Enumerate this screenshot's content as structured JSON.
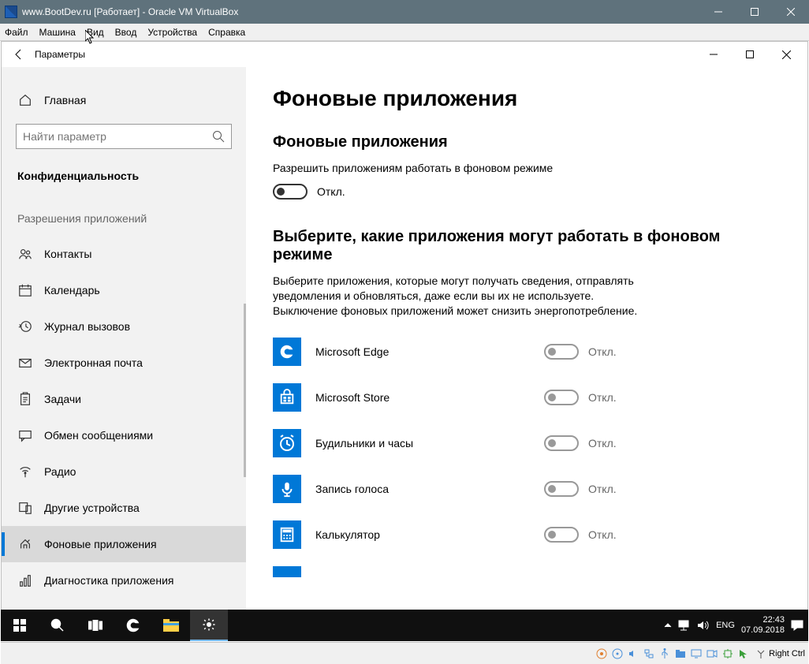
{
  "vbox": {
    "title": "www.BootDev.ru [Работает] - Oracle VM VirtualBox",
    "menu": [
      "Файл",
      "Машина",
      "Вид",
      "Ввод",
      "Устройства",
      "Справка"
    ],
    "host_key": "Right Ctrl"
  },
  "settings": {
    "app_name": "Параметры",
    "home": "Главная",
    "search_placeholder": "Найти параметр",
    "category": "Конфиденциальность",
    "group_label": "Разрешения приложений",
    "nav": [
      {
        "label": "Контакты"
      },
      {
        "label": "Календарь"
      },
      {
        "label": "Журнал вызовов"
      },
      {
        "label": "Электронная почта"
      },
      {
        "label": "Задачи"
      },
      {
        "label": "Обмен сообщениями"
      },
      {
        "label": "Радио"
      },
      {
        "label": "Другие устройства"
      },
      {
        "label": "Фоновые приложения"
      },
      {
        "label": "Диагностика приложения"
      }
    ],
    "active_index": 8
  },
  "page": {
    "title": "Фоновые приложения",
    "section1_title": "Фоновые приложения",
    "allow_desc": "Разрешить приложениям работать в фоновом режиме",
    "allow_state": "Откл.",
    "section2_title": "Выберите, какие приложения могут работать в фоновом режиме",
    "section2_desc": "Выберите приложения, которые могут получать сведения, отправлять уведомления и обновляться, даже если вы их не используете. Выключение фоновых приложений может снизить энергопотребление.",
    "apps": [
      {
        "name": "Microsoft Edge",
        "state": "Откл."
      },
      {
        "name": "Microsoft Store",
        "state": "Откл."
      },
      {
        "name": "Будильники и часы",
        "state": "Откл."
      },
      {
        "name": "Запись голоса",
        "state": "Откл."
      },
      {
        "name": "Калькулятор",
        "state": "Откл."
      }
    ]
  },
  "taskbar": {
    "lang": "ENG",
    "time": "22:43",
    "date": "07.09.2018"
  }
}
